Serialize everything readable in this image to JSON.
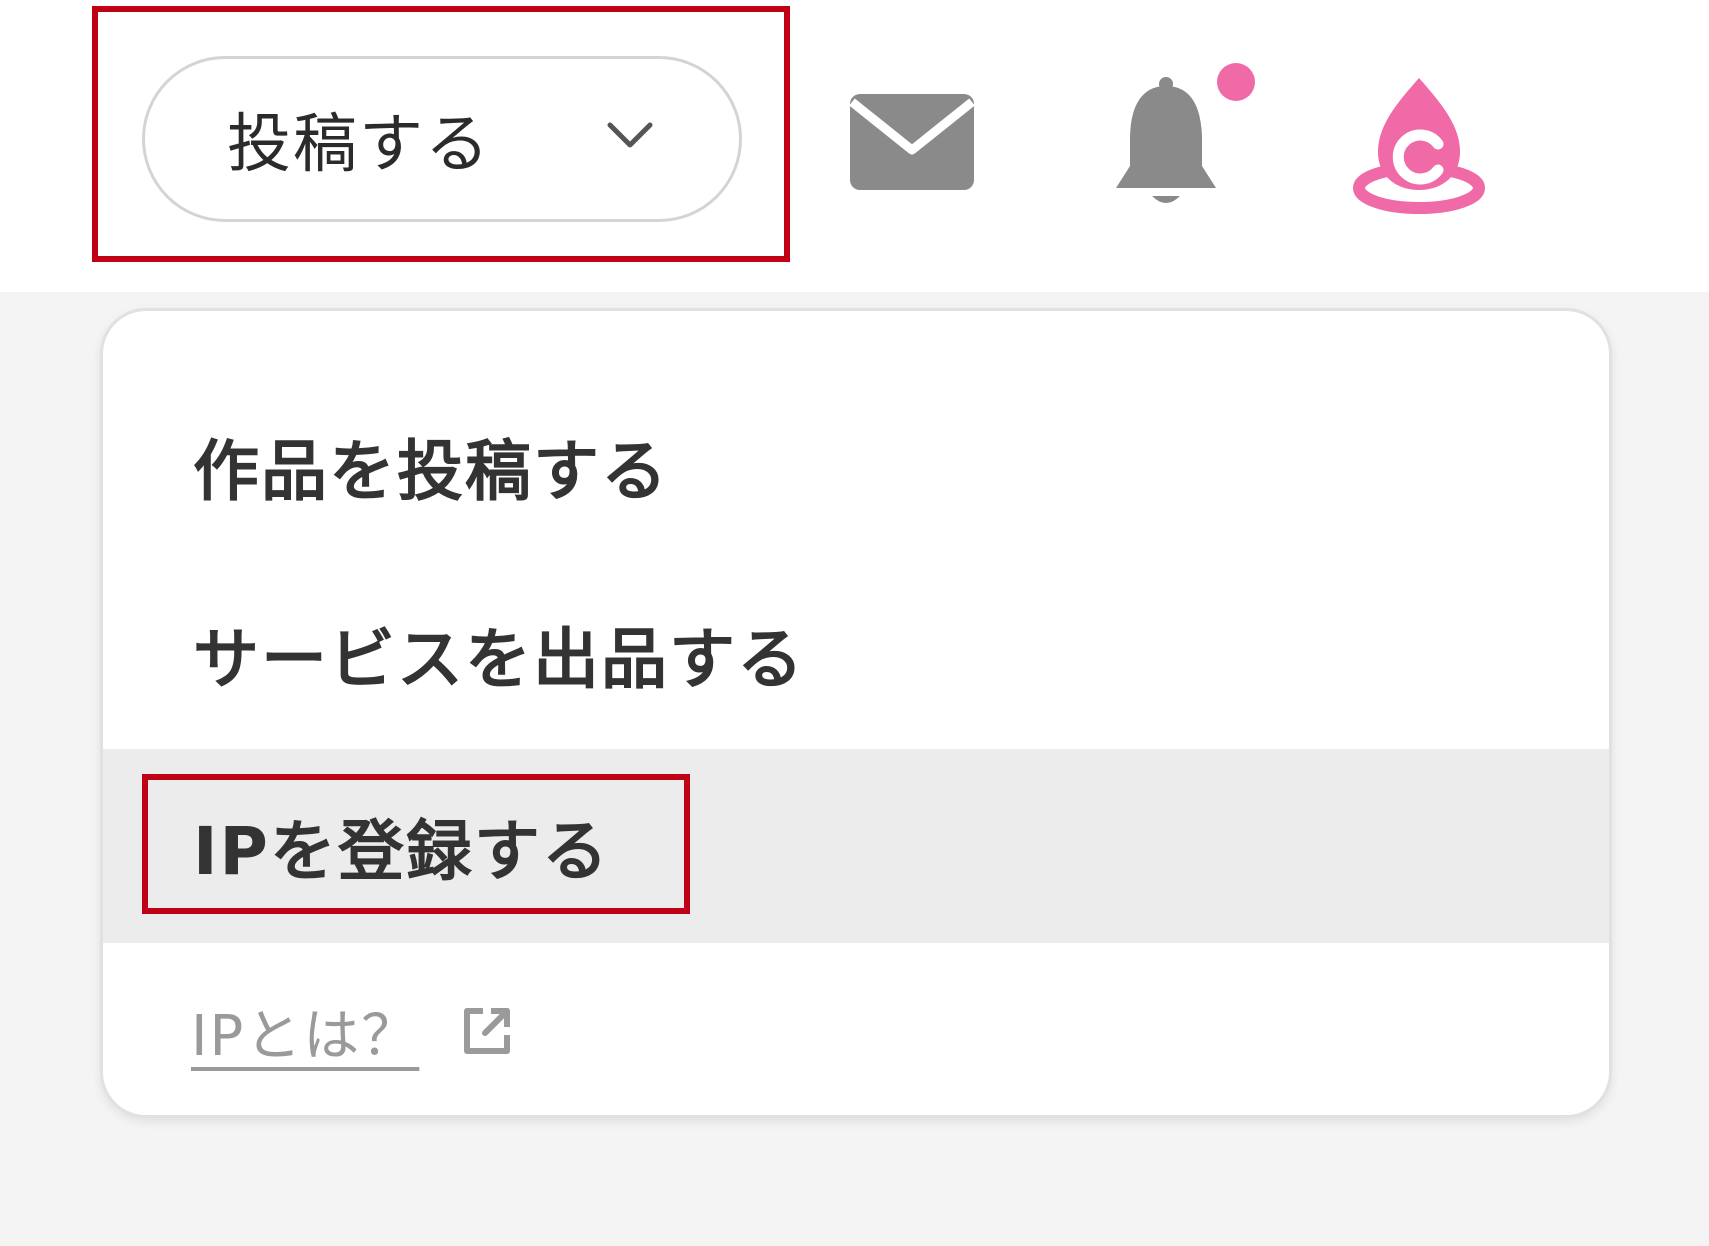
{
  "header": {
    "post_button_label": "投稿する",
    "icons": {
      "post_dropdown": "chevron-down-icon",
      "mail": "mail-icon",
      "notifications": "bell-icon",
      "avatar": "user-avatar-icon"
    },
    "notification_badge_color": "#ef6aa6",
    "avatar_color": "#ef6aa6"
  },
  "dropdown": {
    "items": [
      {
        "label": "作品を投稿する"
      },
      {
        "label": "サービスを出品する"
      },
      {
        "label": "IPを登録する",
        "highlighted": true
      }
    ],
    "help_link": {
      "label": "IPとは？",
      "icon": "external-link-icon"
    }
  },
  "colors": {
    "highlight_border": "#c00014",
    "hover_background": "#ececec",
    "icon_gray": "#8a8a8a"
  }
}
